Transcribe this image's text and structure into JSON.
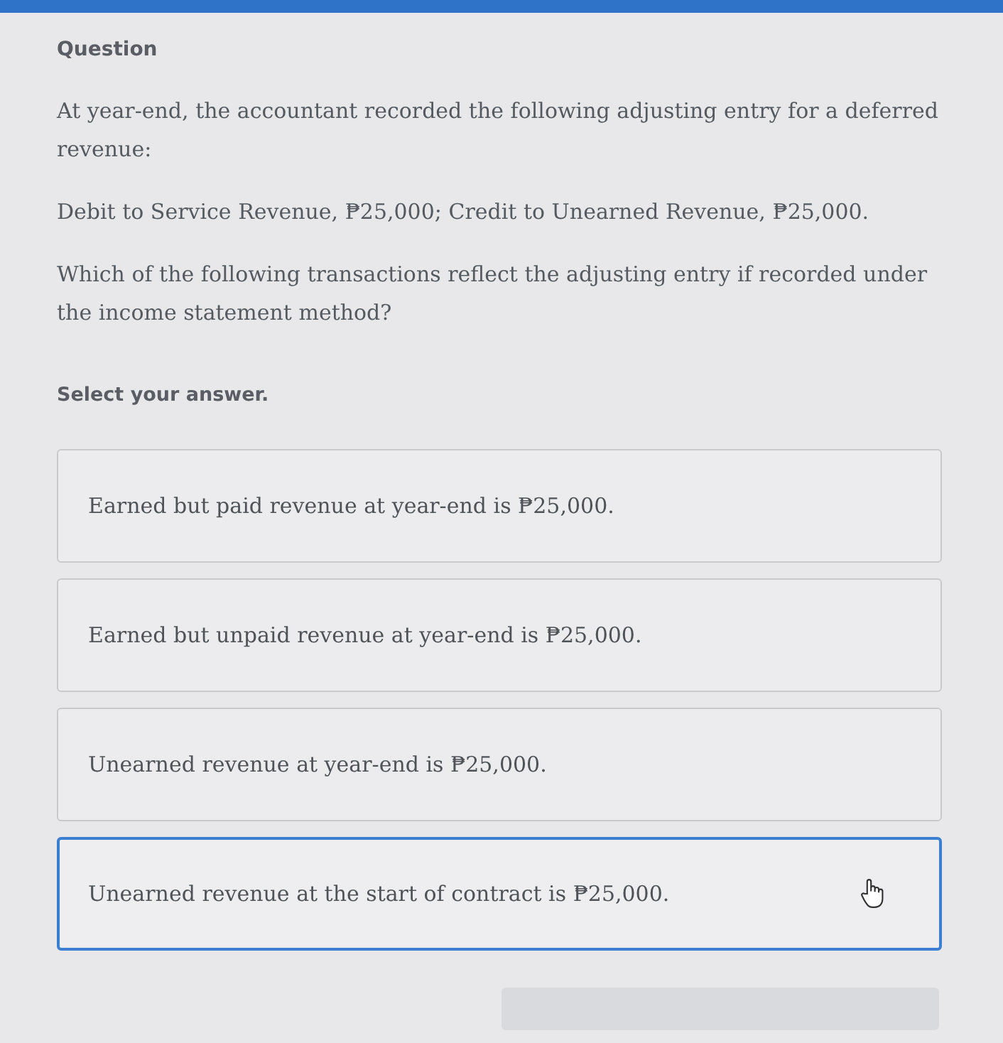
{
  "header": {
    "label": "Question"
  },
  "question": [
    "At year-end, the accountant recorded the following adjusting entry for a deferred revenue:",
    "Debit to Service Revenue, ₱25,000; Credit to Unearned Revenue, ₱25,000.",
    "Which of the following transactions reflect the adjusting entry if recorded under the income statement method?"
  ],
  "prompt": "Select your answer.",
  "options": [
    {
      "text": "Earned but paid revenue at year-end is ₱25,000.",
      "selected": false
    },
    {
      "text": "Earned but unpaid revenue at year-end is ₱25,000.",
      "selected": false
    },
    {
      "text": "Unearned revenue at year-end is ₱25,000.",
      "selected": false
    },
    {
      "text": "Unearned revenue at the start of contract is ₱25,000.",
      "selected": true
    }
  ]
}
